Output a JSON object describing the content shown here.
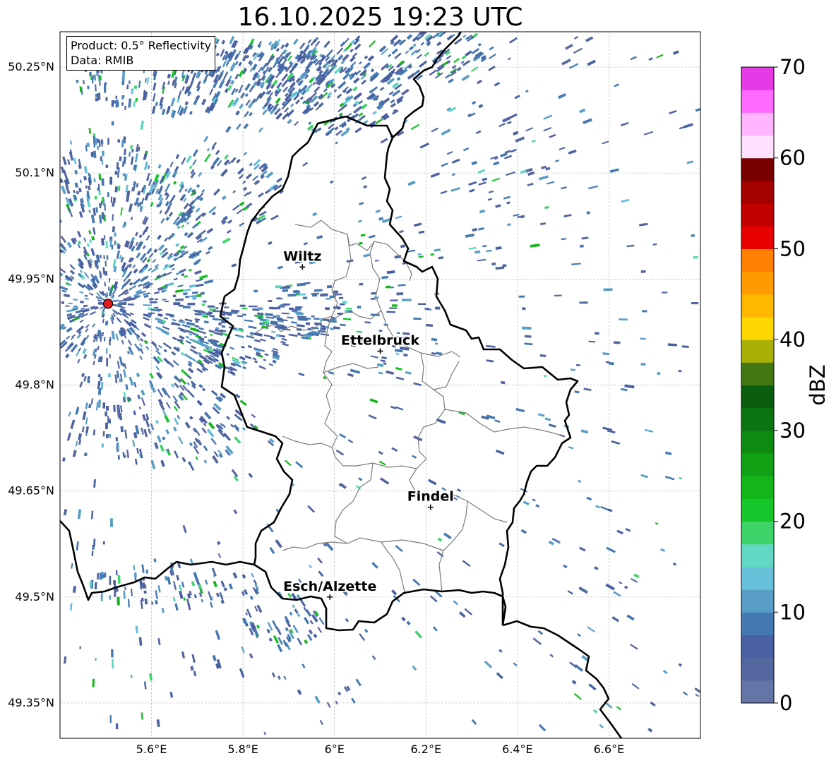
{
  "title": "16.10.2025 19:23 UTC",
  "info": {
    "product": "Product: 0.5° Reflectivity",
    "data": "Data: RMIB"
  },
  "map": {
    "lon_range": [
      5.4,
      6.8
    ],
    "lat_range": [
      49.3,
      50.3
    ],
    "x_ticks": [
      {
        "value": 5.6,
        "label": "5.6°E"
      },
      {
        "value": 5.8,
        "label": "5.8°E"
      },
      {
        "value": 6.0,
        "label": "6°E"
      },
      {
        "value": 6.2,
        "label": "6.2°E"
      },
      {
        "value": 6.4,
        "label": "6.4°E"
      },
      {
        "value": 6.6,
        "label": "6.6°E"
      }
    ],
    "y_ticks": [
      {
        "value": 50.25,
        "label": "50.25°N"
      },
      {
        "value": 50.1,
        "label": "50.1°N"
      },
      {
        "value": 49.95,
        "label": "49.95°N"
      },
      {
        "value": 49.8,
        "label": "49.8°N"
      },
      {
        "value": 49.65,
        "label": "49.65°N"
      },
      {
        "value": 49.5,
        "label": "49.5°N"
      },
      {
        "value": 49.35,
        "label": "49.35°N"
      }
    ],
    "cities": [
      {
        "name": "Wiltz",
        "lon": 5.93,
        "lat": 49.967
      },
      {
        "name": "Ettelbruck",
        "lon": 6.1,
        "lat": 49.848
      },
      {
        "name": "Findel",
        "lon": 6.21,
        "lat": 49.627
      },
      {
        "name": "Esch/Alzette",
        "lon": 5.99,
        "lat": 49.5
      }
    ],
    "radar_site": {
      "lon": 5.505,
      "lat": 49.915,
      "color": "#e31a1c"
    }
  },
  "colorbar": {
    "label": "dBZ",
    "min": 0,
    "max": 70,
    "ticks": [
      0,
      10,
      20,
      30,
      40,
      50,
      60,
      70
    ],
    "colors": [
      "#6475a8",
      "#55679f",
      "#4961a3",
      "#4579b2",
      "#589ec7",
      "#68c0db",
      "#62d7c4",
      "#3fd46a",
      "#16c62a",
      "#12b619",
      "#10a114",
      "#0e8a11",
      "#0b7511",
      "#0a5e0d",
      "#437714",
      "#a9b107",
      "#ffd700",
      "#ffb700",
      "#ff9b00",
      "#ff7f00",
      "#e60000",
      "#c20000",
      "#a50000",
      "#7a0000",
      "#ffe0ff",
      "#ffb5ff",
      "#ff6bff",
      "#e63ae6"
    ]
  }
}
